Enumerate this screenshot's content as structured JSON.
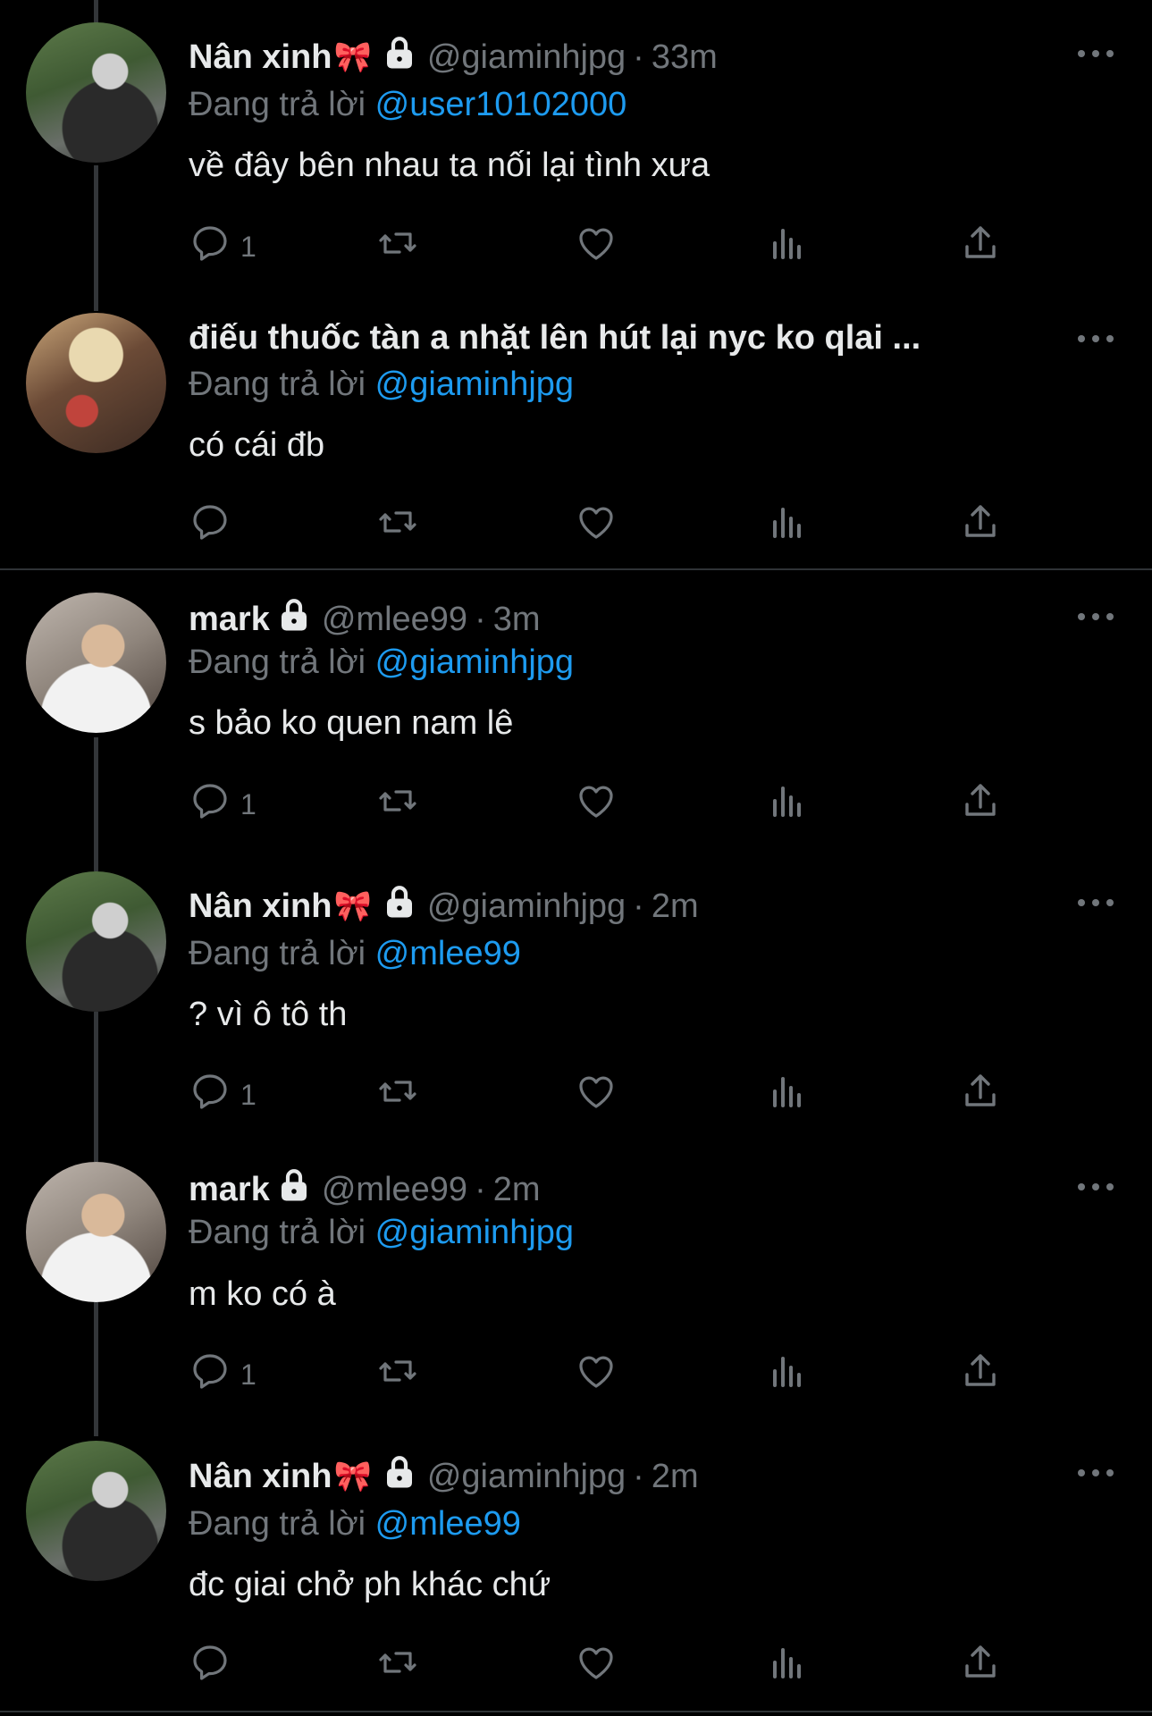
{
  "reply_prefix": "Đang trả lời",
  "tweets": [
    {
      "name": "Nân xinh",
      "bow": "🎀",
      "handle": "@giaminhjpg",
      "dot": "·",
      "time": "33m",
      "reply_to": "@user10102000",
      "text": "về đây bên nhau ta nối lại tình xưa",
      "reply_count": "1"
    },
    {
      "name": "điếu thuốc tàn a nhặt lên hút lại nyc ko qlai ...",
      "reply_to": "@giaminhjpg",
      "text": "có cái đb",
      "reply_count": ""
    },
    {
      "name": "mark",
      "handle": "@mlee99",
      "dot": "·",
      "time": "3m",
      "reply_to": "@giaminhjpg",
      "text": "s bảo ko quen nam lê",
      "reply_count": "1"
    },
    {
      "name": "Nân xinh",
      "bow": "🎀",
      "handle": "@giaminhjpg",
      "dot": "·",
      "time": "2m",
      "reply_to": "@mlee99",
      "text": "? vì ô tô th",
      "reply_count": "1"
    },
    {
      "name": "mark",
      "handle": "@mlee99",
      "dot": "·",
      "time": "2m",
      "reply_to": "@giaminhjpg",
      "text": "m ko có à",
      "reply_count": "1"
    },
    {
      "name": "Nân xinh",
      "bow": "🎀",
      "handle": "@giaminhjpg",
      "dot": "·",
      "time": "2m",
      "reply_to": "@mlee99",
      "text": "đc giai chở ph khác chứ",
      "reply_count": ""
    }
  ],
  "icons": [
    "reply-icon",
    "retweet-icon",
    "like-icon",
    "views-icon",
    "share-icon",
    "lock-icon",
    "more-icon"
  ],
  "colors": {
    "background": "#000000",
    "text": "#e7e9ea",
    "secondary": "#71767b",
    "mention": "#1d9bf0",
    "divider": "#2f3336"
  }
}
